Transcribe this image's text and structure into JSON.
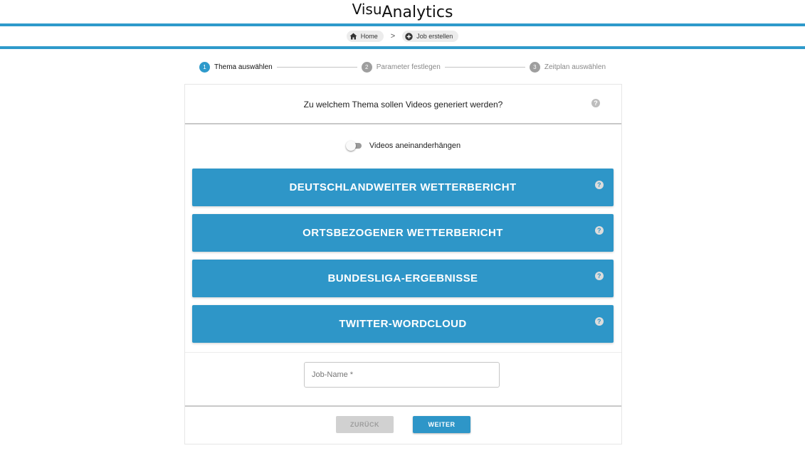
{
  "app": {
    "logo_part1": "Visu",
    "logo_part2": "Analytics"
  },
  "breadcrumb": {
    "home": "Home",
    "home_icon": "home-icon",
    "separator": ">",
    "current": "Job erstellen",
    "current_icon": "add-circle-icon"
  },
  "stepper": {
    "steps": [
      {
        "number": "1",
        "label": "Thema auswählen",
        "state": "active"
      },
      {
        "number": "2",
        "label": "Parameter festlegen",
        "state": "inactive"
      },
      {
        "number": "3",
        "label": "Zeitplan auswählen",
        "state": "inactive"
      }
    ]
  },
  "form": {
    "question": "Zu welchem Thema sollen Videos generiert werden?",
    "help_glyph": "?",
    "toggle_label": "Videos aneinanderhängen",
    "toggle_state": "off",
    "topics": [
      "DEUTSCHLANDWEITER WETTERBERICHT",
      "ORTSBEZOGENER WETTERBERICHT",
      "BUNDESLIGA-ERGEBNISSE",
      "TWITTER-WORDCLOUD"
    ],
    "job_name_placeholder": "Job-Name *",
    "job_name_value": "",
    "back_label": "ZURÜCK",
    "next_label": "WEITER"
  },
  "colors": {
    "accent": "#2e96c8",
    "bar": "#2e9acb",
    "disabled": "#d1d1d1"
  }
}
